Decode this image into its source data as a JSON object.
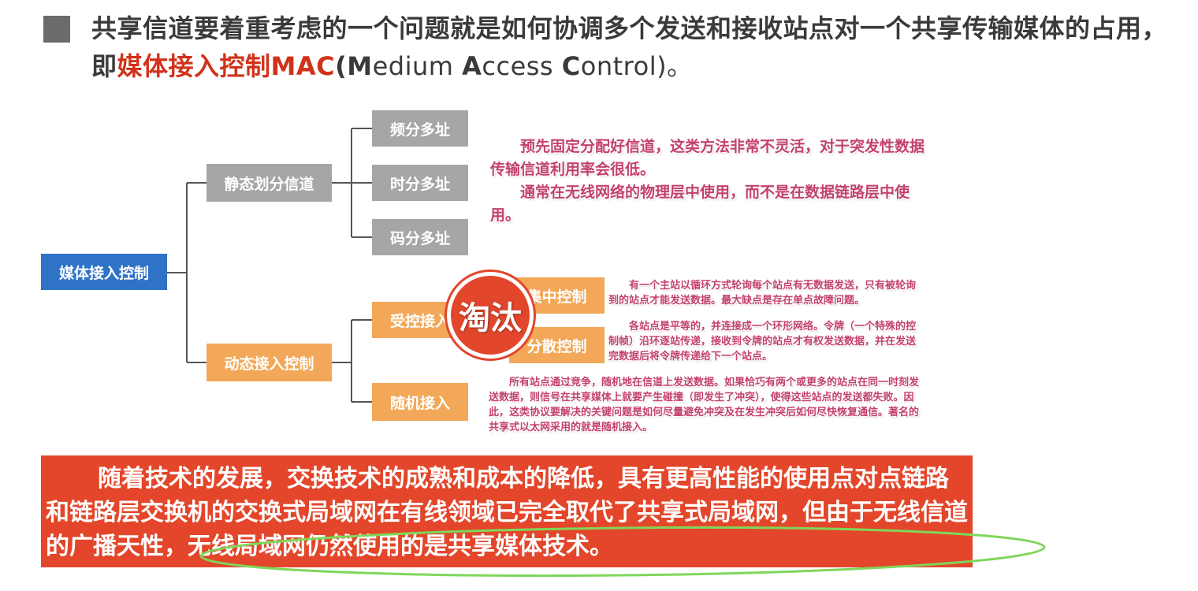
{
  "title": {
    "prefix": "共享信道要着重考虑的一个问题就是如何协调多个发送和接收站点对一个共享传输媒体的占用，即",
    "mac_cn": "媒体接入控制MAC",
    "paren_open": "(",
    "m": "M",
    "edium": "edium ",
    "a": "A",
    "ccess": "ccess ",
    "c": "C",
    "ontrol": "ontrol)。"
  },
  "tree": {
    "root": "媒体接入控制",
    "static": {
      "label": "静态划分信道",
      "children": [
        "频分多址",
        "时分多址",
        "码分多址"
      ]
    },
    "dynamic": {
      "label": "动态接入控制",
      "controlled": {
        "label": "受控接入",
        "children": [
          "集中控制",
          "分散控制"
        ]
      },
      "random": "随机接入"
    }
  },
  "notes": {
    "static_p1": "预先固定分配好信道，这类方法非常不灵活，对于突发性数据传输信道利用率会很低。",
    "static_p2": "通常在无线网络的物理层中使用，而不是在数据链路层中使用。",
    "centralized": "有一个主站以循环方式轮询每个站点有无数据发送，只有被轮询到的站点才能发送数据。最大缺点是存在单点故障问题。",
    "distributed": "各站点是平等的，并连接成一个环形网络。令牌（一个特殊的控制帧）沿环逐站传递，接收到令牌的站点才有权发送数据，并在发送完数据后将令牌传递给下一个站点。",
    "random": "所有站点通过竞争，随机地在信道上发送数据。如果恰巧有两个或更多的站点在同一时刻发送数据，则信号在共享媒体上就要产生碰撞（即发生了冲突），使得这些站点的发送都失败。因此，这类协议要解决的关键问题是如何尽量避免冲突及在发生冲突后如何尽快恢复通信。著名的共享式以太网采用的就是随机接入。"
  },
  "stamp": "淘汰",
  "banner": "随着技术的发展，交换技术的成熟和成本的降低，具有更高性能的使用点对点链路和链路层交换机的交换式局域网在有线领域已完全取代了共享式局域网，但由于无线信道的广播天性，无线局域网仍然使用的是共享媒体技术。",
  "colors": {
    "accent_red": "#d0321a",
    "root_blue": "#2e73c6",
    "static_gray": "#a6a6a6",
    "dynamic_orange": "#f2a858",
    "note_pink": "#c3416e",
    "banner_red": "#e3462a",
    "ellipse_green": "#7fd65a"
  },
  "icons": {
    "title_bullet": "square-bullet-icon"
  }
}
